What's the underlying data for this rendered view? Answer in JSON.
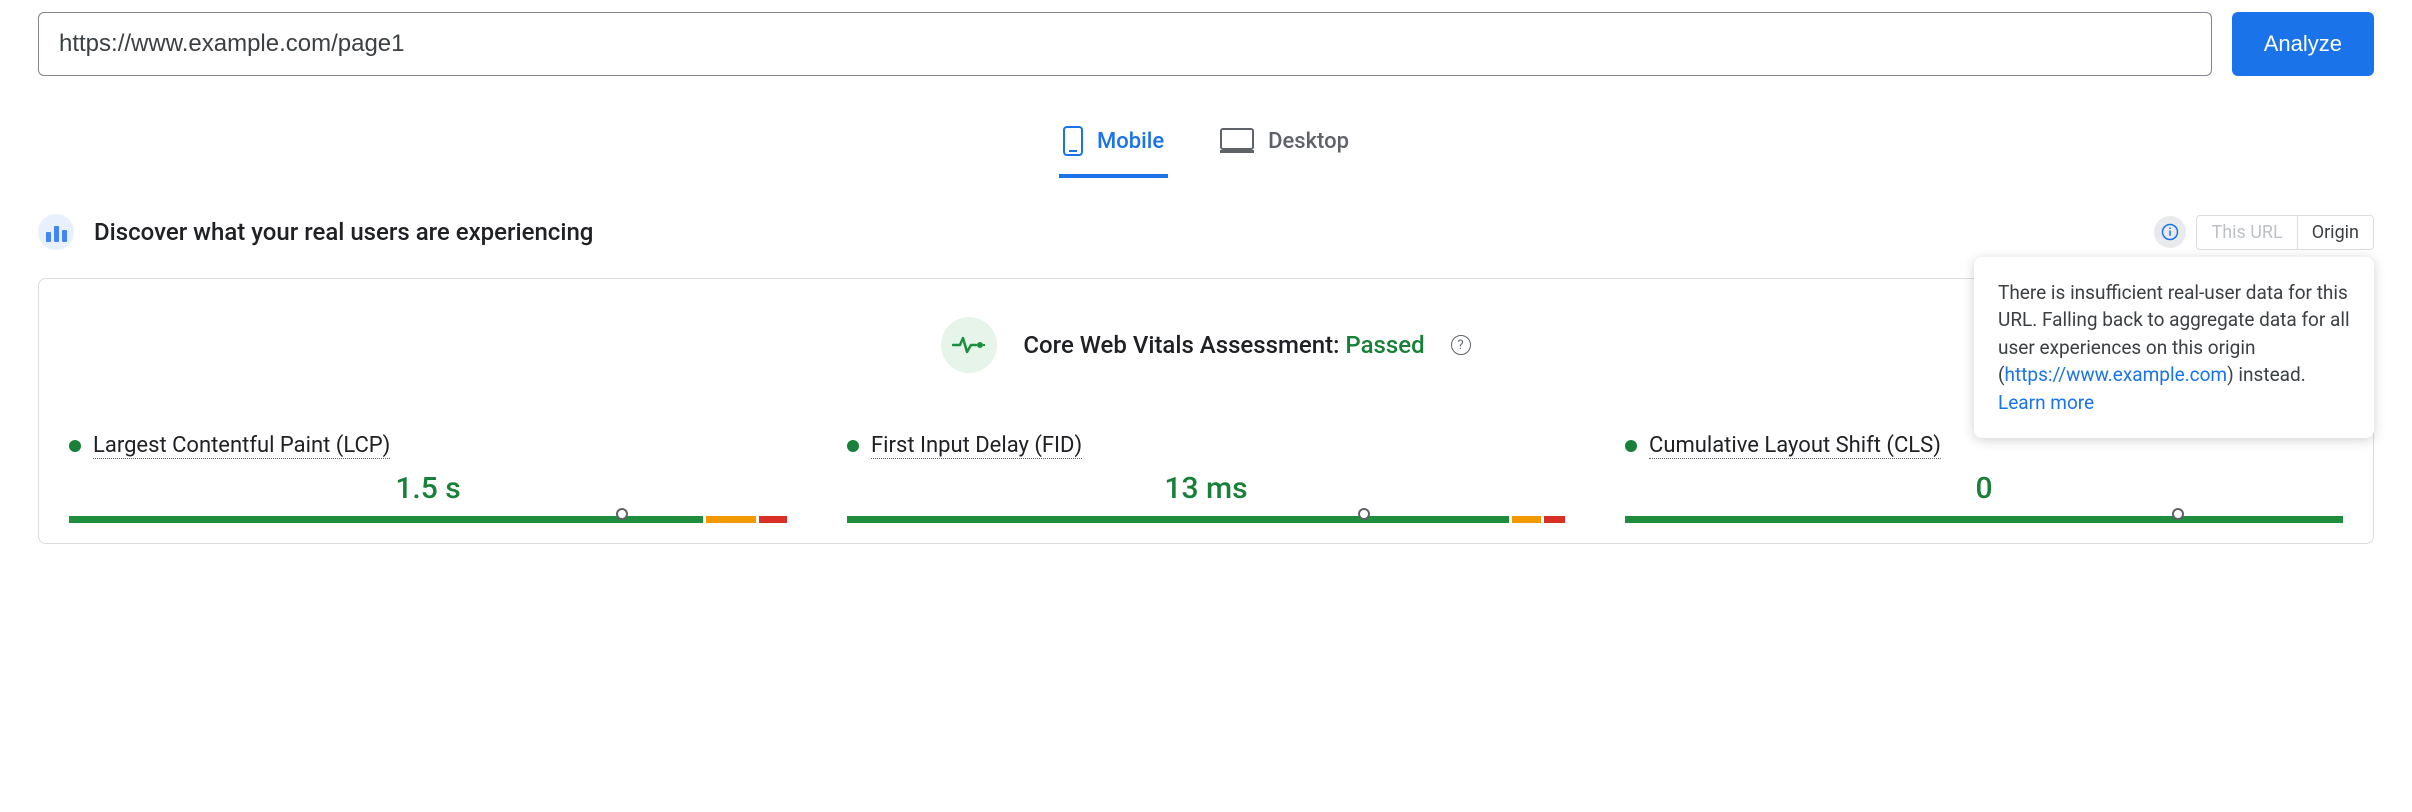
{
  "input": {
    "url": "https://www.example.com/page1",
    "analyze_label": "Analyze"
  },
  "tabs": {
    "mobile": "Mobile",
    "desktop": "Desktop"
  },
  "section": {
    "title": "Discover what your real users are experiencing"
  },
  "toggle": {
    "this_url": "This URL",
    "origin": "Origin"
  },
  "popover": {
    "pre": "There is insufficient real-user data for this URL. Falling back to aggregate data for all user experiences on this origin (",
    "origin_link": "https://www.example.com",
    "post": ") instead. ",
    "learn": "Learn more"
  },
  "assessment": {
    "prefix": "Core Web Vitals Assessment: ",
    "status": "Passed"
  },
  "metrics": {
    "lcp": {
      "name": "Largest Contentful Paint (LCP)",
      "value": "1.5 s"
    },
    "fid": {
      "name": "First Input Delay (FID)",
      "value": "13 ms"
    },
    "cls": {
      "name": "Cumulative Layout Shift (CLS)",
      "value": "0"
    }
  }
}
